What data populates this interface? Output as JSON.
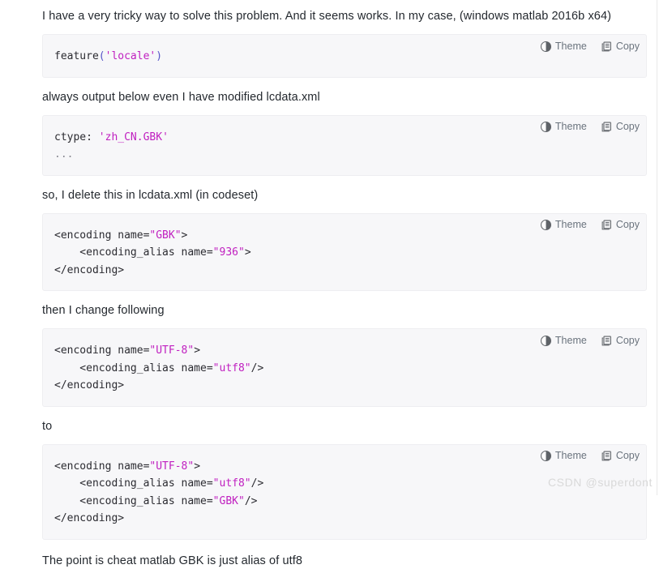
{
  "document": {
    "watermark": "CSDN @superdont"
  },
  "code_toolbar": {
    "theme_label": "Theme",
    "copy_label": "Copy",
    "theme_icon": "contrast-circle-icon",
    "copy_icon": "copy-document-icon"
  },
  "blocks": [
    {
      "type": "paragraph",
      "text": "I have a very tricky way to solve this problem. And it seems works. In my case, (windows matlab 2016b x64)"
    },
    {
      "type": "code",
      "language": "matlab",
      "lines": [
        [
          {
            "t": "plain",
            "s": "feature"
          },
          {
            "t": "punct",
            "s": "("
          },
          {
            "t": "str",
            "s": "'locale'"
          },
          {
            "t": "punct",
            "s": ")"
          }
        ]
      ]
    },
    {
      "type": "paragraph",
      "text": "always output below even I have modified lcdata.xml"
    },
    {
      "type": "code",
      "language": "text",
      "lines": [
        [
          {
            "t": "plain",
            "s": "ctype: "
          },
          {
            "t": "str",
            "s": "'zh_CN.GBK'"
          }
        ],
        [
          {
            "t": "dots",
            "s": "..."
          }
        ]
      ]
    },
    {
      "type": "paragraph",
      "text": "so, I delete this in lcdata.xml (in codeset)"
    },
    {
      "type": "code",
      "language": "xml",
      "lines": [
        [
          {
            "t": "plain",
            "s": "<encoding name="
          },
          {
            "t": "str",
            "s": "\"GBK\""
          },
          {
            "t": "plain",
            "s": ">"
          }
        ],
        [
          {
            "t": "plain",
            "s": "    <encoding_alias name="
          },
          {
            "t": "str",
            "s": "\"936\""
          },
          {
            "t": "plain",
            "s": ">"
          }
        ],
        [
          {
            "t": "plain",
            "s": "</encoding>"
          }
        ]
      ]
    },
    {
      "type": "paragraph",
      "text": "then I change following"
    },
    {
      "type": "code",
      "language": "xml",
      "lines": [
        [
          {
            "t": "plain",
            "s": "<encoding name="
          },
          {
            "t": "str",
            "s": "\"UTF-8\""
          },
          {
            "t": "plain",
            "s": ">"
          }
        ],
        [
          {
            "t": "plain",
            "s": "    <encoding_alias name="
          },
          {
            "t": "str",
            "s": "\"utf8\""
          },
          {
            "t": "plain",
            "s": "/>"
          }
        ],
        [
          {
            "t": "plain",
            "s": "</encoding>"
          }
        ]
      ]
    },
    {
      "type": "paragraph",
      "text": "to"
    },
    {
      "type": "code",
      "language": "xml",
      "lines": [
        [
          {
            "t": "plain",
            "s": "<encoding name="
          },
          {
            "t": "str",
            "s": "\"UTF-8\""
          },
          {
            "t": "plain",
            "s": ">"
          }
        ],
        [
          {
            "t": "plain",
            "s": "    <encoding_alias name="
          },
          {
            "t": "str",
            "s": "\"utf8\""
          },
          {
            "t": "plain",
            "s": "/>"
          }
        ],
        [
          {
            "t": "plain",
            "s": "    <encoding_alias name="
          },
          {
            "t": "str",
            "s": "\"GBK\""
          },
          {
            "t": "plain",
            "s": "/>"
          }
        ],
        [
          {
            "t": "plain",
            "s": "</encoding>"
          }
        ]
      ]
    },
    {
      "type": "paragraph",
      "text": "The point is cheat matlab GBK is just alias of utf8"
    }
  ],
  "colors": {
    "code_background": "#f7f7f9",
    "string_token": "#c020c0",
    "punct_token": "#5555c8",
    "text": "#24292f",
    "toolbar_label": "#6a737d",
    "watermark": "#d9d9d9"
  }
}
